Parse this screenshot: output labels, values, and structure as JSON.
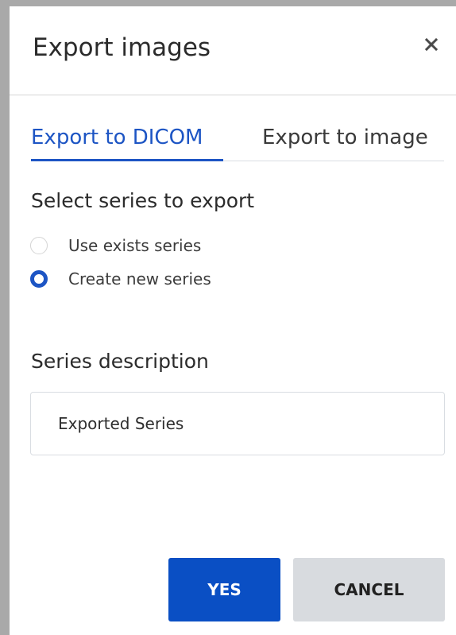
{
  "dialog": {
    "title": "Export images",
    "close_icon": "close-icon"
  },
  "tabs": [
    {
      "label": "Export to DICOM",
      "active": true
    },
    {
      "label": "Export to image",
      "active": false
    }
  ],
  "series_select": {
    "heading": "Select series to export",
    "options": [
      {
        "label": "Use exists series",
        "selected": false
      },
      {
        "label": "Create new series",
        "selected": true
      }
    ]
  },
  "series_description": {
    "heading": "Series description",
    "value": "Exported Series"
  },
  "buttons": {
    "yes_label": "YES",
    "cancel_label": "CANCEL"
  },
  "colors": {
    "accent": "#1d55c4",
    "primary_button": "#0a4fc4",
    "secondary_button": "#d8dbdf",
    "frame": "#a9a9a9"
  }
}
